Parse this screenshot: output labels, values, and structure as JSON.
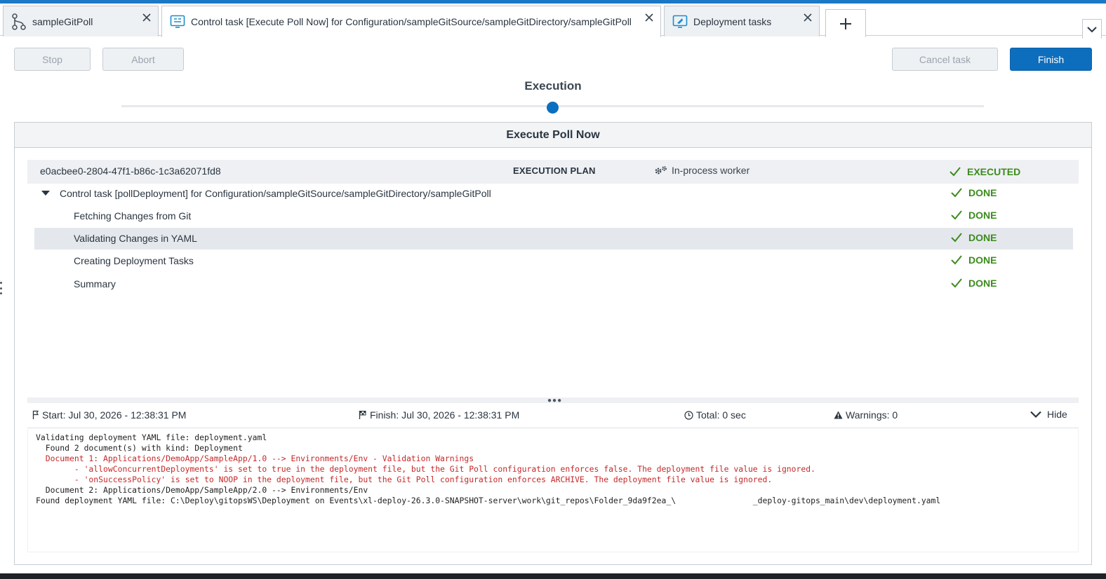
{
  "tabs": [
    {
      "label": "sampleGitPoll",
      "icon": "git-branch-icon",
      "active": false
    },
    {
      "label": "Control task [Execute Poll Now] for Configuration/sampleGitSource/sampleGitDirectory/sampleGitPoll",
      "icon": "control-task-icon",
      "active": true
    },
    {
      "label": "Deployment tasks",
      "icon": "deployment-rocket-icon",
      "active": false
    }
  ],
  "toolbar": {
    "stop_label": "Stop",
    "abort_label": "Abort",
    "cancel_label": "Cancel task",
    "finish_label": "Finish"
  },
  "stepper": {
    "title": "Execution"
  },
  "panel": {
    "title": "Execute Poll Now",
    "plan": {
      "task_id": "e0acbee0-2804-47f1-b86c-1c3a62071fd8",
      "label": "EXECUTION PLAN",
      "worker": "In-process worker",
      "status": "EXECUTED"
    },
    "group": {
      "label": "Control task [pollDeployment] for Configuration/sampleGitSource/sampleGitDirectory/sampleGitPoll",
      "status": "DONE"
    },
    "steps": [
      {
        "label": "Fetching Changes from Git",
        "status": "DONE"
      },
      {
        "label": "Validating Changes in YAML",
        "status": "DONE"
      },
      {
        "label": "Creating Deployment Tasks",
        "status": "DONE"
      },
      {
        "label": "Summary",
        "status": "DONE"
      }
    ]
  },
  "info": {
    "start": "Start: Jul 30, 2026 - 12:38:31 PM",
    "finish": "Finish: Jul 30, 2026 - 12:38:31 PM",
    "total": "Total: 0 sec",
    "warnings": "Warnings: 0",
    "hide_label": "Hide"
  },
  "log": [
    {
      "text": "Validating deployment YAML file: deployment.yaml",
      "level": "info"
    },
    {
      "text": "  Found 2 document(s) with kind: Deployment",
      "level": "info"
    },
    {
      "text": "  Document 1: Applications/DemoApp/SampleApp/1.0 --> Environments/Env - Validation Warnings",
      "level": "warn"
    },
    {
      "text": "        - 'allowConcurrentDeployments' is set to true in the deployment file, but the Git Poll configuration enforces false. The deployment file value is ignored.",
      "level": "warn"
    },
    {
      "text": "        - 'onSuccessPolicy' is set to NOOP in the deployment file, but the Git Poll configuration enforces ARCHIVE. The deployment file value is ignored.",
      "level": "warn"
    },
    {
      "text": "  Document 2: Applications/DemoApp/SampleApp/2.0 --> Environments/Env",
      "level": "info"
    },
    {
      "text": "Found deployment YAML file: C:\\Deploy\\gitopsWS\\Deployment on Events\\xl-deploy-26.3.0-SNAPSHOT-server\\work\\git_repos\\Folder_9da9f2ea_\\                _deploy-gitops_main\\dev\\deployment.yaml",
      "level": "info"
    }
  ],
  "colors": {
    "accent": "#0d6ebd",
    "success": "#3d8b1d",
    "warning_text": "#c62828"
  }
}
